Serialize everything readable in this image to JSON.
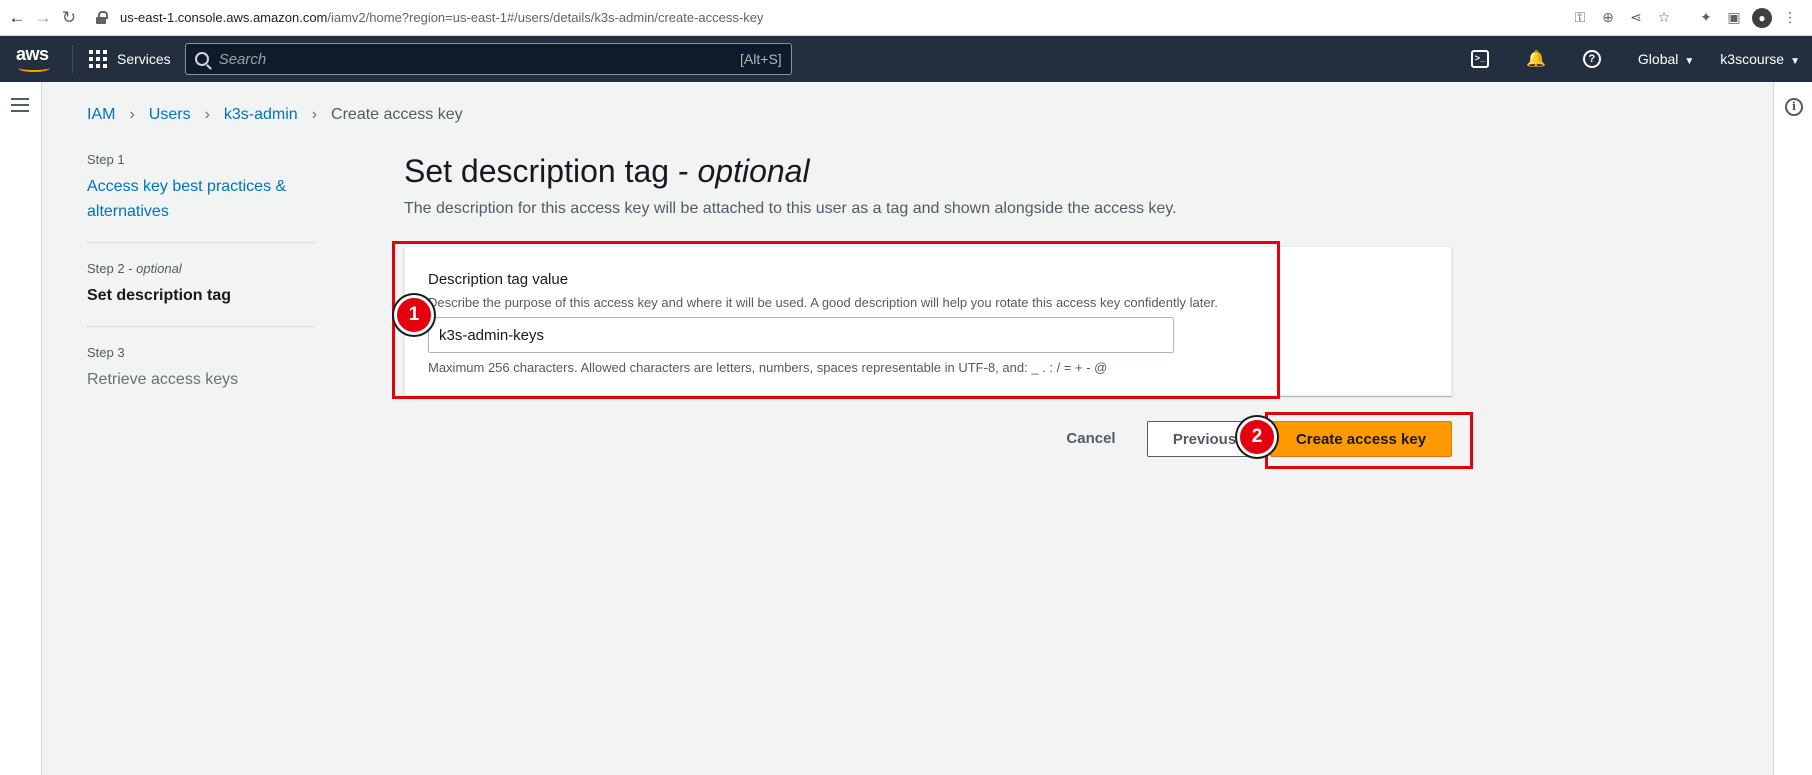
{
  "browser": {
    "url_host": "us-east-1.console.aws.amazon.com",
    "url_path": "/iamv2/home?region=us-east-1#/users/details/k3s-admin/create-access-key",
    "profile_initial": "●"
  },
  "awsnav": {
    "logo": "aws",
    "services_label": "Services",
    "search_placeholder": "Search",
    "search_shortcut": "[Alt+S]",
    "cloudshell_glyph": ">_",
    "bell_glyph": "🔔",
    "help_glyph": "?",
    "region": "Global",
    "account": "k3scourse"
  },
  "breadcrumb": {
    "items": [
      "IAM",
      "Users",
      "k3s-admin",
      "Create access key"
    ],
    "separator": "›"
  },
  "steps": [
    {
      "label": "Step 1",
      "title": "Access key best practices & alternatives"
    },
    {
      "label": "Step 2",
      "label_optional": "optional",
      "title": "Set description tag"
    },
    {
      "label": "Step 3",
      "title": "Retrieve access keys"
    }
  ],
  "main": {
    "title": "Set description tag - ",
    "title_optional": "optional",
    "description": "The description for this access key will be attached to this user as a tag and shown alongside the access key."
  },
  "form": {
    "label": "Description tag value",
    "description": "Describe the purpose of this access key and where it will be used. A good description will help you rotate this access key confidently later.",
    "value": "k3s-admin-keys",
    "constraint": "Maximum 256 characters. Allowed characters are letters, numbers, spaces representable in UTF-8, and: _ . : / = + - @"
  },
  "actions": {
    "cancel": "Cancel",
    "previous": "Previous",
    "create": "Create access key"
  },
  "annotations": {
    "badge1": "1",
    "badge2": "2"
  },
  "colors": {
    "nav_bg": "#232f3e",
    "link": "#0073bb",
    "primary_button": "#ff9900",
    "highlight": "#e3000f"
  }
}
